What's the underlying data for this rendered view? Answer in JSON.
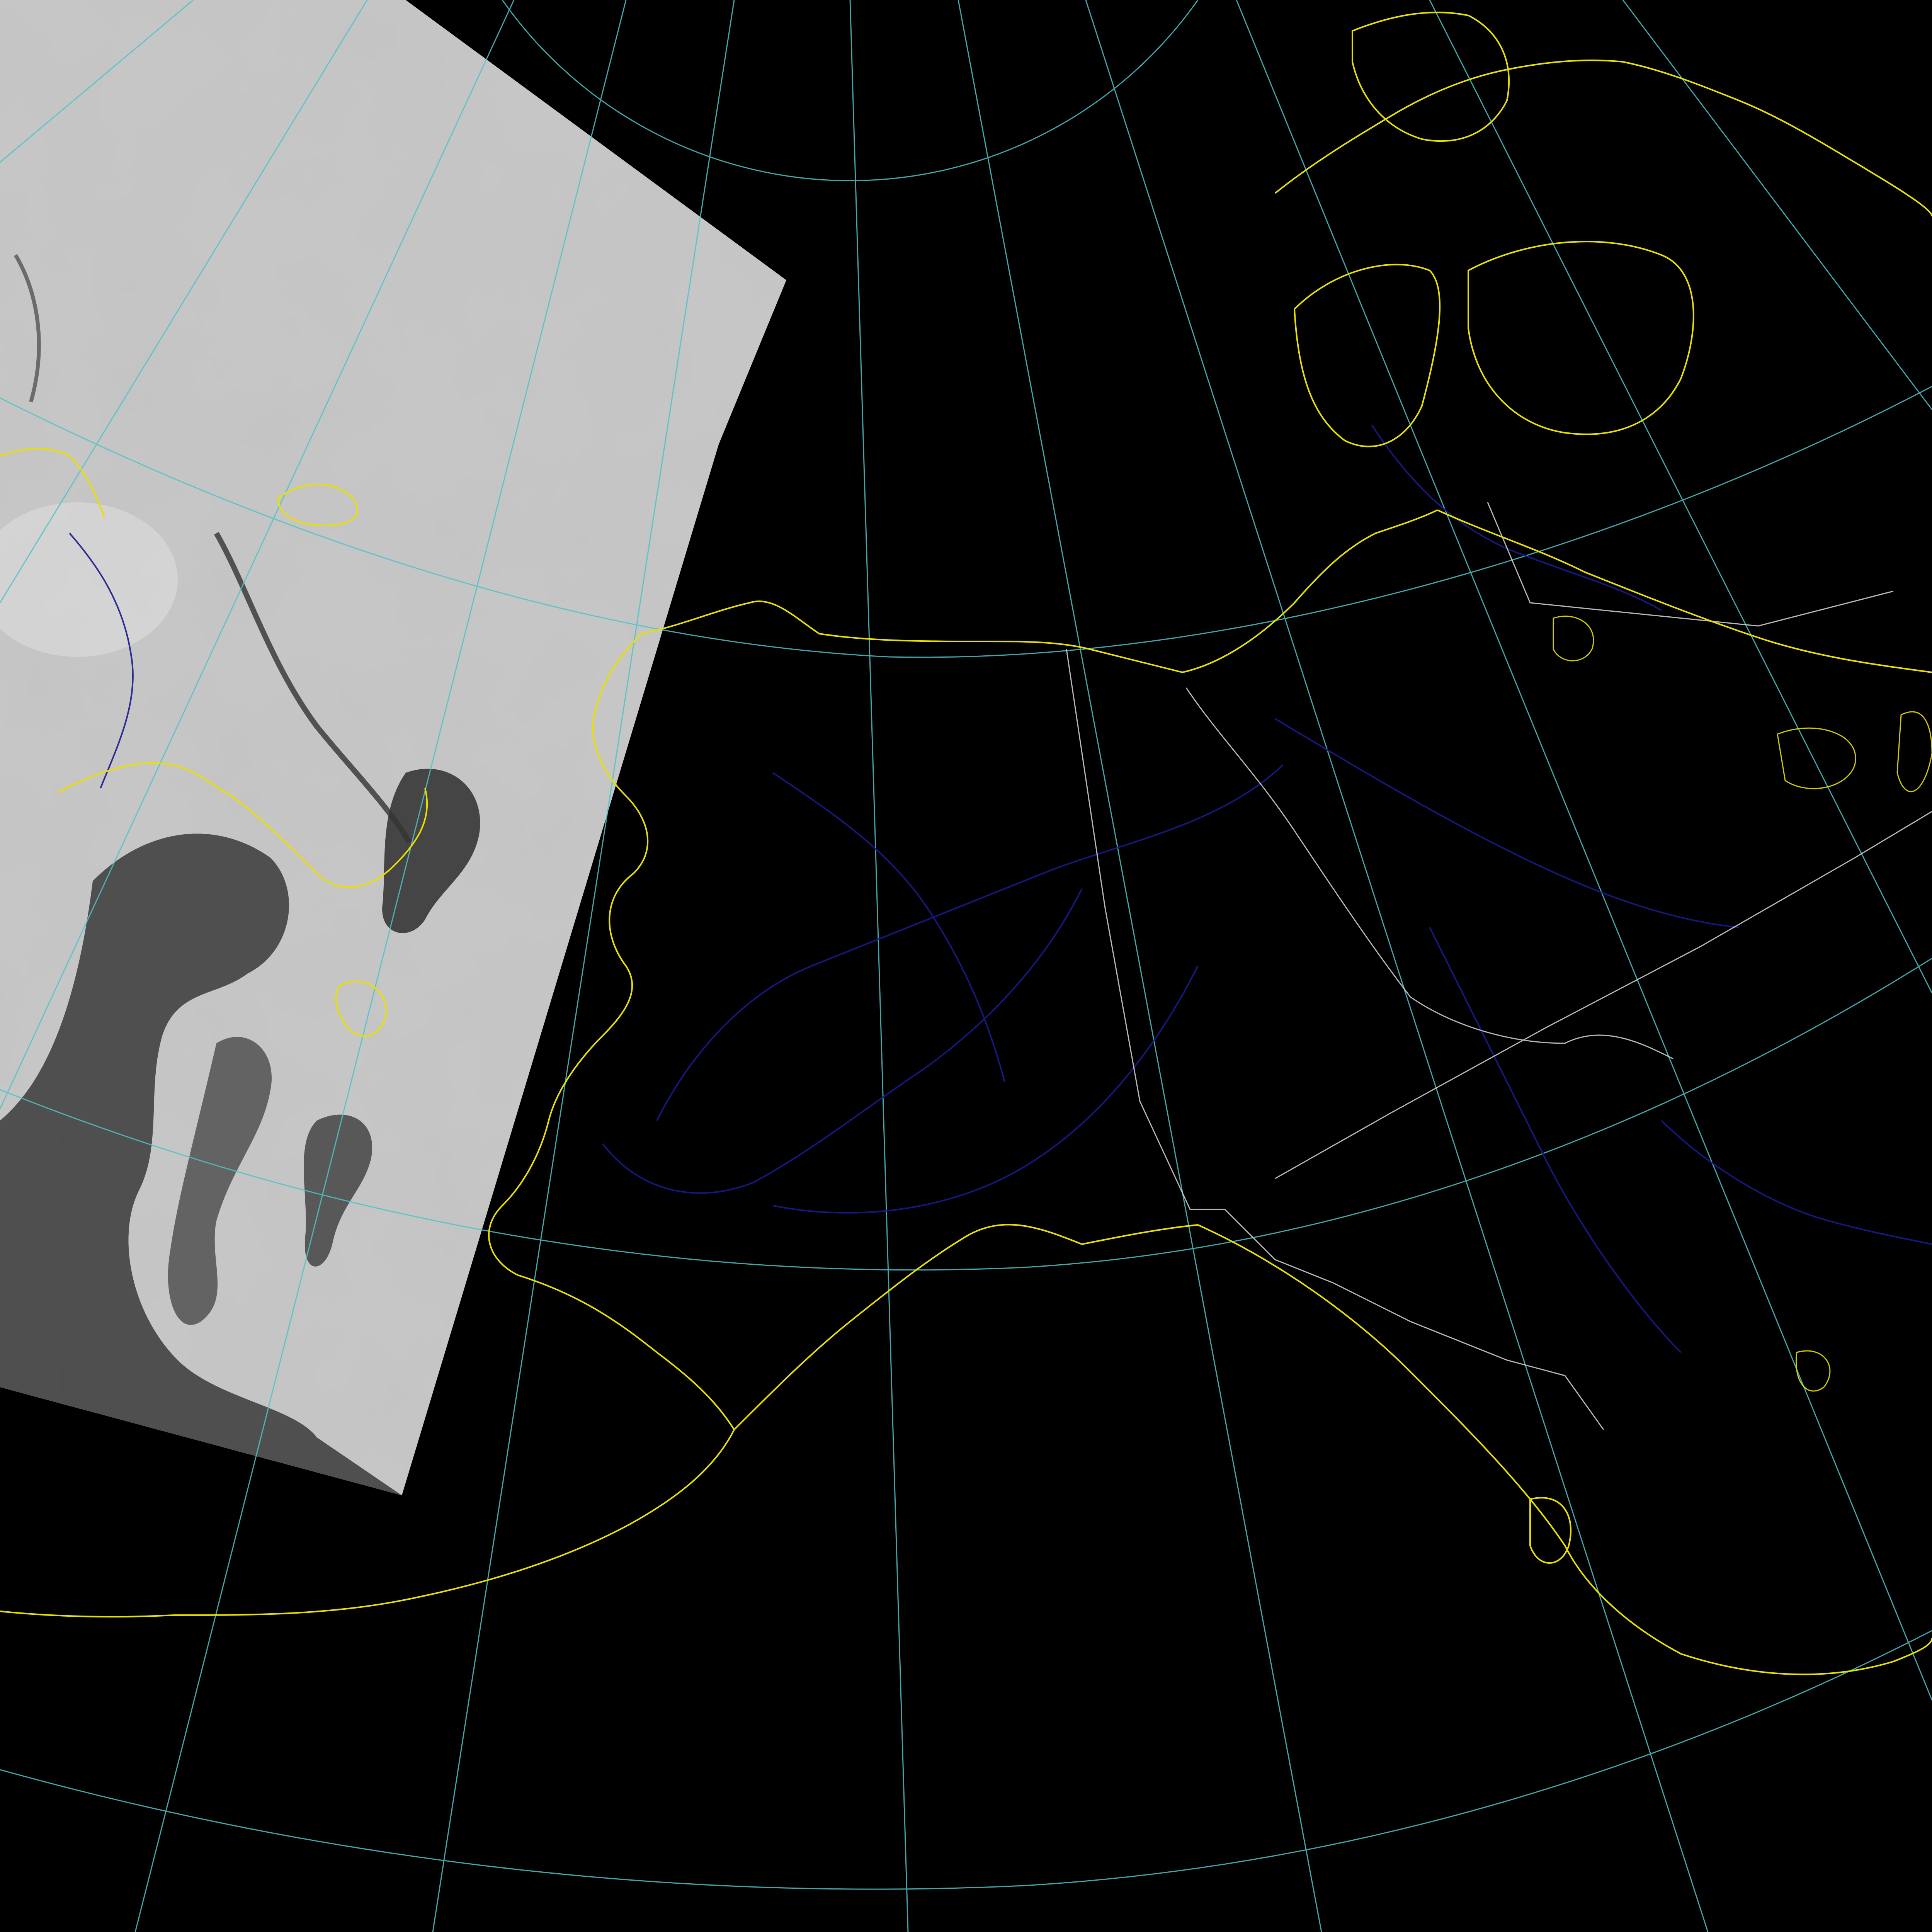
{
  "map": {
    "projection": "polar-stereographic",
    "background_color": "#000000"
  },
  "layers": {
    "satellite_swath": {
      "description_visible": false,
      "tint": "#bcbcbc"
    },
    "graticule": {
      "color": "#4fc3c8"
    },
    "coastlines": {
      "color": "#e8e000"
    },
    "rivers": {
      "color": "#1a1a8c"
    },
    "political_borders": {
      "color": "#d8d8d8"
    }
  }
}
